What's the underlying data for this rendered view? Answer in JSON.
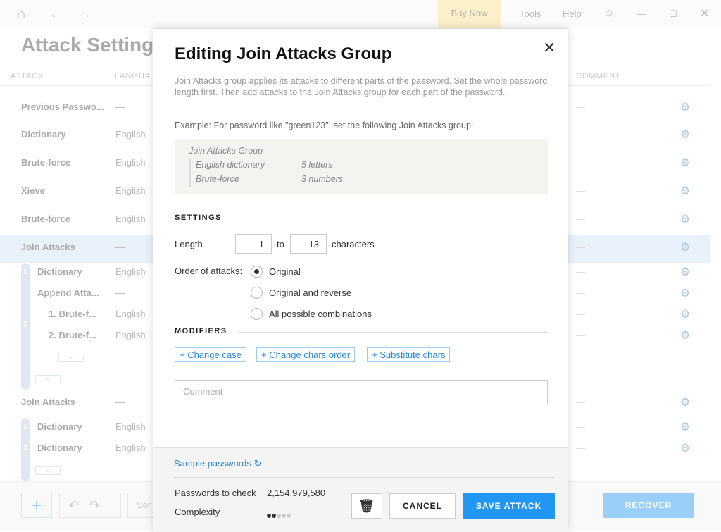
{
  "topbar": {
    "buy_now": "Buy Now",
    "tools": "Tools",
    "help": "Help"
  },
  "page": {
    "title": "Attack Setting",
    "columns": {
      "attack": "ATTACK",
      "language": "LANGUA",
      "comment": "COMMENT"
    }
  },
  "rows": [
    {
      "name": "Previous Passwo...",
      "language": "—",
      "comment": "—"
    },
    {
      "name": "Dictionary",
      "language": "English",
      "comment": "—"
    },
    {
      "name": "Brute-force",
      "language": "English",
      "comment": "—"
    },
    {
      "name": "Xieve",
      "language": "English",
      "comment": "—"
    },
    {
      "name": "Brute-force",
      "language": "English",
      "comment": "—"
    },
    {
      "name": "Join Attacks",
      "language": "—",
      "comment": "—"
    },
    {
      "name": "Dictionary",
      "language": "English",
      "comment": "—"
    },
    {
      "name": "Append Atta...",
      "language": "—",
      "comment": "—"
    },
    {
      "name": "1. Brute-f...",
      "language": "English",
      "comment": "—"
    },
    {
      "name": "2. Brute-f...",
      "language": "English",
      "comment": "—"
    },
    {
      "name": "Join Attacks",
      "language": "—",
      "comment": "—"
    },
    {
      "name": "Dictionary",
      "language": "English",
      "comment": "—"
    },
    {
      "name": "Dictionary",
      "language": "English",
      "comment": "—"
    }
  ],
  "footer": {
    "sort": "Sor",
    "recover": "RECOVER"
  },
  "modal": {
    "title": "Editing Join Attacks Group",
    "description": "Join Attacks group applies its attacks to different parts of the password. Set the whole password length first. Then add attacks to the Join Attacks group for each part of the password.",
    "example": "Example: For password like \"green123\", set the following Join Attacks group:",
    "example_box": {
      "title": "Join Attacks Group",
      "items": [
        {
          "attack": "English dictionary",
          "part": "5 letters"
        },
        {
          "attack": "Brute-force",
          "part": "3 numbers"
        }
      ]
    },
    "settings_label": "SETTINGS",
    "length_label": "Length",
    "length_from": "1",
    "to_label": "to",
    "length_to": "13",
    "characters_label": "characters",
    "order_label": "Order of attacks:",
    "order_options": [
      {
        "label": "Original",
        "selected": true
      },
      {
        "label": "Original and reverse",
        "selected": false
      },
      {
        "label": "All possible combinations",
        "selected": false
      }
    ],
    "modifiers_label": "MODIFIERS",
    "modifiers": [
      "+ Change case",
      "+ Change chars order",
      "+ Substitute chars"
    ],
    "comment_placeholder": "Comment",
    "sample_passwords": "Sample passwords",
    "passwords_to_check_label": "Passwords to check",
    "passwords_to_check": "2,154,979,580",
    "complexity_label": "Complexity",
    "complexity_level": 2,
    "complexity_max": 5,
    "cancel": "CANCEL",
    "save": "SAVE ATTACK"
  },
  "colors": {
    "accent": "#2196f3",
    "selected_row": "#cfe3f7",
    "buy_now": "#f7df8a"
  }
}
